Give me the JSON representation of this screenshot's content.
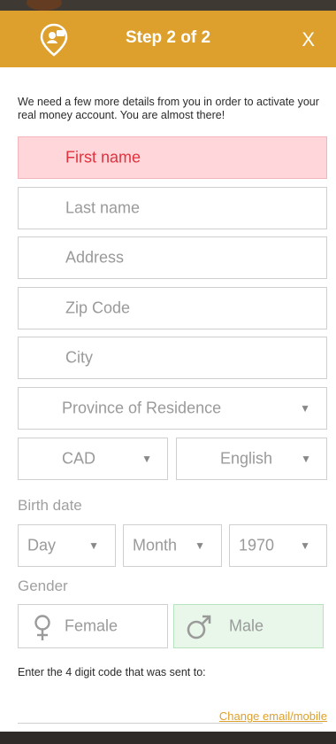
{
  "header": {
    "title": "Step 2 of 2",
    "close_label": "X"
  },
  "intro": "We need a few more details from you in order to activate your real money account. You are almost there!",
  "fields": {
    "first_name": "First name",
    "last_name": "Last name",
    "address": "Address",
    "zip": "Zip Code",
    "city": "City",
    "province": "Province of Residence",
    "currency": "CAD",
    "language": "English"
  },
  "birth": {
    "label": "Birth date",
    "day": "Day",
    "month": "Month",
    "year": "1970"
  },
  "gender": {
    "label": "Gender",
    "female": "Female",
    "male": "Male",
    "selected": "male"
  },
  "code": {
    "instruction": "Enter the 4 digit code that was sent to:",
    "change_link": "Change email/mobile"
  },
  "colors": {
    "accent": "#dda02c",
    "error_bg": "#ffd6d9",
    "error_text": "#e0323f",
    "selected_bg": "#e8f7ea"
  }
}
